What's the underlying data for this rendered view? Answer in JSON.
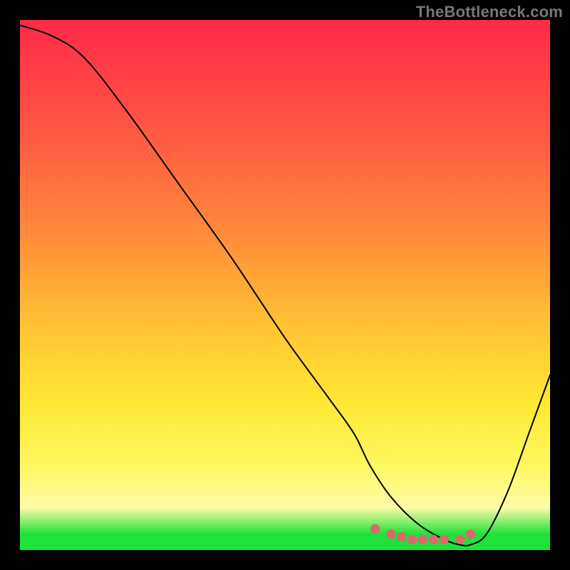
{
  "watermark": "TheBottleneck.com",
  "gradient": {
    "top": "#ff2a47",
    "mid": "#ffe833",
    "bottom_band": "#1de23a"
  },
  "chart_data": {
    "type": "line",
    "title": "",
    "xlabel": "",
    "ylabel": "",
    "xlim": [
      0,
      100
    ],
    "ylim": [
      0,
      100
    ],
    "series": [
      {
        "name": "bottleneck-curve",
        "x": [
          0,
          6,
          12,
          20,
          30,
          40,
          50,
          58,
          63,
          66,
          70,
          75,
          80,
          83,
          85,
          88,
          92,
          96,
          100
        ],
        "values": [
          99,
          97,
          93,
          83,
          69,
          55,
          40,
          29,
          22,
          16,
          10,
          5,
          2,
          1,
          1,
          3,
          11,
          22,
          33
        ]
      }
    ],
    "markers": {
      "name": "flat-segment-dots",
      "color": "#d86b68",
      "x": [
        67,
        70,
        72,
        74,
        76,
        78,
        80,
        83,
        85
      ],
      "values": [
        4,
        3,
        2.5,
        2,
        2,
        2,
        2,
        2,
        3
      ]
    }
  }
}
